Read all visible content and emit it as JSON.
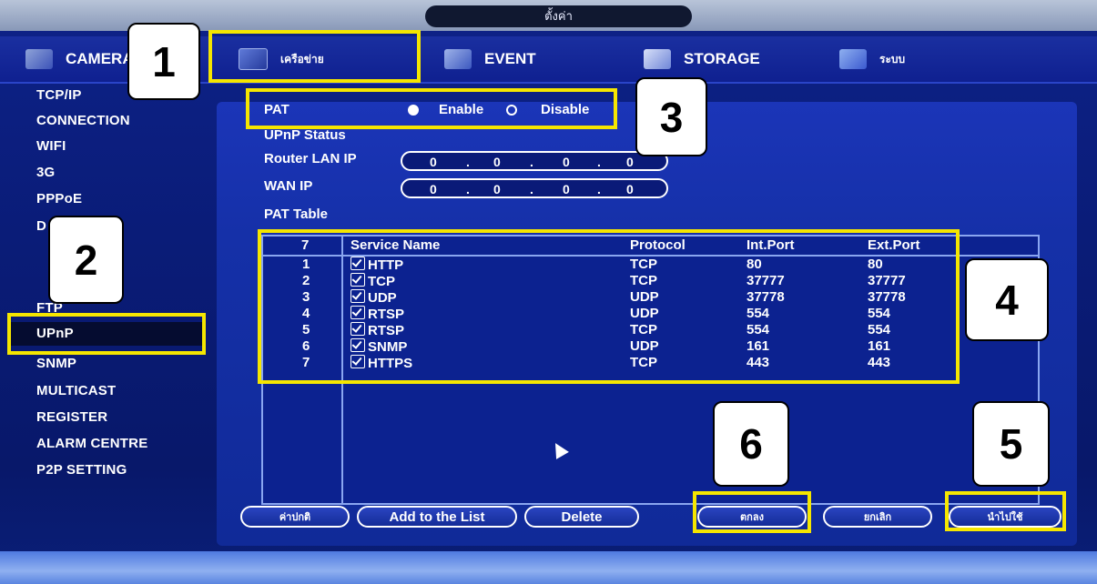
{
  "window": {
    "title": "ตั้งค่า"
  },
  "top_tabs": [
    {
      "label": "CAMERA",
      "icon": "camera-icon"
    },
    {
      "label": "เครือข่าย",
      "icon": "network-icon"
    },
    {
      "label": "EVENT",
      "icon": "event-icon"
    },
    {
      "label": "STORAGE",
      "icon": "storage-icon"
    },
    {
      "label": "ระบบ",
      "icon": "system-icon"
    }
  ],
  "sidebar": {
    "active": "UPnP",
    "items": [
      "TCP/IP",
      "CONNECTION",
      "WIFI",
      "3G",
      "PPPoE",
      "D",
      "",
      "",
      "FTP",
      "UPnP",
      "SNMP",
      "MULTICAST",
      "REGISTER",
      "ALARM CENTRE",
      "P2P SETTING"
    ]
  },
  "pat": {
    "label": "PAT",
    "enable_label": "Enable",
    "disable_label": "Disable",
    "value": "Enable"
  },
  "upnp_status": {
    "label": "UPnP Status"
  },
  "router_lan_ip": {
    "label": "Router LAN IP",
    "octets": [
      "0",
      "0",
      "0",
      "0"
    ]
  },
  "wan_ip": {
    "label": "WAN IP",
    "octets": [
      "0",
      "0",
      "0",
      "0"
    ]
  },
  "pat_table": {
    "label": "PAT Table",
    "count": "7",
    "columns": [
      "Service Name",
      "Protocol",
      "Int.Port",
      "Ext.Port"
    ],
    "rows": [
      {
        "no": "1",
        "service": "HTTP",
        "protocol": "TCP",
        "int_port": "80",
        "ext_port": "80",
        "checked": true
      },
      {
        "no": "2",
        "service": "TCP",
        "protocol": "TCP",
        "int_port": "37777",
        "ext_port": "37777",
        "checked": true
      },
      {
        "no": "3",
        "service": "UDP",
        "protocol": "UDP",
        "int_port": "37778",
        "ext_port": "37778",
        "checked": true
      },
      {
        "no": "4",
        "service": "RTSP",
        "protocol": "UDP",
        "int_port": "554",
        "ext_port": "554",
        "checked": true
      },
      {
        "no": "5",
        "service": "RTSP",
        "protocol": "TCP",
        "int_port": "554",
        "ext_port": "554",
        "checked": true
      },
      {
        "no": "6",
        "service": "SNMP",
        "protocol": "UDP",
        "int_port": "161",
        "ext_port": "161",
        "checked": true
      },
      {
        "no": "7",
        "service": "HTTPS",
        "protocol": "TCP",
        "int_port": "443",
        "ext_port": "443",
        "checked": true
      }
    ]
  },
  "buttons": {
    "default": "ค่าปกติ",
    "add": "Add to the List",
    "delete": "Delete",
    "ok": "ตกลง",
    "cancel": "ยกเลิก",
    "apply": "นำไปใช้"
  },
  "callouts": [
    "1",
    "2",
    "3",
    "4",
    "5",
    "6"
  ],
  "colors": {
    "highlight": "#f5e600",
    "background": "#0a1a6e",
    "panel": "#1530a8"
  }
}
